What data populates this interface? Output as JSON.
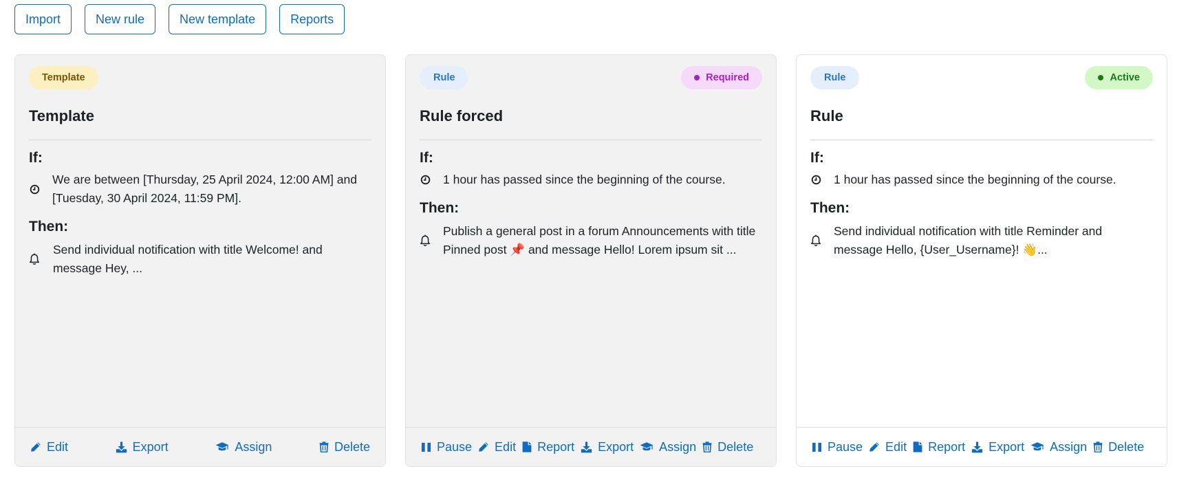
{
  "toolbar": {
    "import_label": "Import",
    "new_rule_label": "New rule",
    "new_template_label": "New template",
    "reports_label": "Reports"
  },
  "colors": {
    "accent": "#0f6cbf",
    "template_badge_bg": "#fcefc0",
    "required_badge_bg": "#f5dbf9",
    "active_badge_bg": "#d3f8c6",
    "rule_badge_bg": "#e5effb"
  },
  "cards": [
    {
      "type_badge": "Template",
      "title": "Template",
      "if_label": "If:",
      "condition": "We are between [Thursday, 25 April 2024, 12:00 AM] and [Tuesday, 30 April 2024, 11:59 PM].",
      "condition_icon": "clock-icon",
      "then_label": "Then:",
      "action": "Send individual notification with title Welcome! and message Hey, ...",
      "action_icon": "bell-icon",
      "footer": {
        "edit": "Edit",
        "export": "Export",
        "assign": "Assign",
        "delete": "Delete"
      }
    },
    {
      "type_badge": "Rule",
      "status_badge": "Required",
      "title": "Rule forced",
      "if_label": "If:",
      "condition": "1 hour has passed since the beginning of the course.",
      "condition_icon": "clock-icon",
      "then_label": "Then:",
      "action": "Publish a general post in a forum Announcements with title Pinned post 📌 and message Hello! Lorem ipsum sit ...",
      "action_icon": "bell-icon",
      "footer": {
        "pause": "Pause",
        "edit": "Edit",
        "report": "Report",
        "export": "Export",
        "assign": "Assign",
        "delete": "Delete"
      }
    },
    {
      "type_badge": "Rule",
      "status_badge": "Active",
      "title": "Rule",
      "if_label": "If:",
      "condition": "1 hour has passed since the beginning of the course.",
      "condition_icon": "clock-icon",
      "then_label": "Then:",
      "action": "Send individual notification with title Reminder and message Hello, {User_Username}! 👋...",
      "action_icon": "bell-icon",
      "footer": {
        "pause": "Pause",
        "edit": "Edit",
        "report": "Report",
        "export": "Export",
        "assign": "Assign",
        "delete": "Delete"
      }
    }
  ]
}
